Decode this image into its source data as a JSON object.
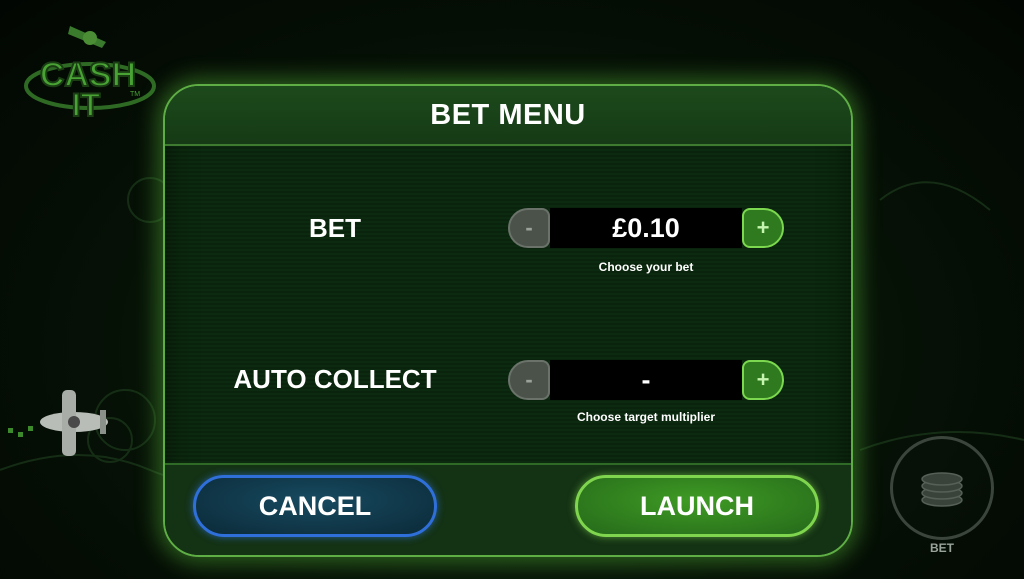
{
  "logo": {
    "line1": "CASH",
    "line2": "IT",
    "tm": "TM"
  },
  "modal": {
    "title": "BET MENU",
    "bet": {
      "label": "BET",
      "value": "£0.10",
      "hint": "Choose your bet",
      "minus": "-",
      "plus": "+"
    },
    "auto_collect": {
      "label": "AUTO COLLECT",
      "value": "-",
      "hint": "Choose target multiplier",
      "minus": "-",
      "plus": "+"
    },
    "cancel_label": "CANCEL",
    "launch_label": "LAUNCH"
  },
  "bet_button": {
    "label": "BET",
    "icon": "coin-stack-icon"
  },
  "colors": {
    "accent_green": "#5fae45",
    "cancel_blue": "#2f6fd9",
    "launch_green": "#3f9b24"
  }
}
